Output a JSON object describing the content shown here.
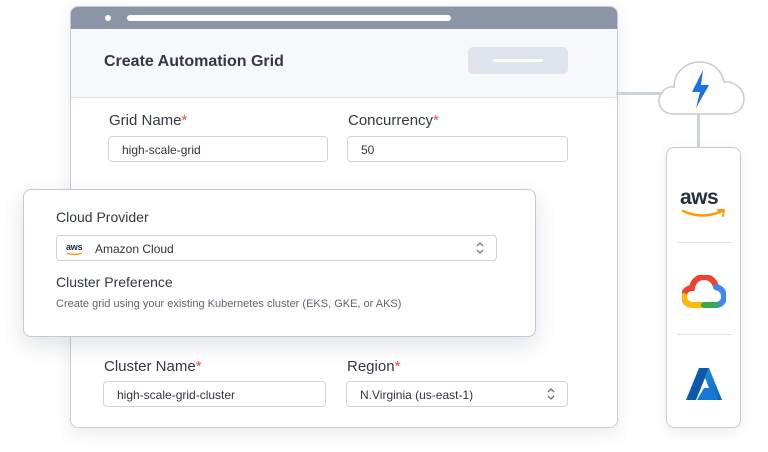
{
  "form": {
    "title": "Create Automation Grid",
    "grid_name_label": "Grid Name",
    "grid_name_value": "high-scale-grid",
    "concurrency_label": "Concurrency",
    "concurrency_value": "50",
    "cluster_name_label": "Cluster Name",
    "cluster_name_value": "high-scale-grid-cluster",
    "region_label": "Region",
    "region_value": "N.Virginia (us-east-1)",
    "required_mark": "*"
  },
  "card": {
    "cloud_provider_label": "Cloud Provider",
    "cloud_provider_value": "Amazon Cloud",
    "cloud_provider_icon_text": "aws",
    "cluster_pref_label": "Cluster Preference",
    "cluster_pref_hint": "Create grid using  your existing Kubernetes cluster (EKS, GKE, or AKS)"
  },
  "providers": {
    "aws_text": "aws",
    "items": [
      "aws-logo",
      "google-cloud-logo",
      "azure-logo"
    ]
  },
  "colors": {
    "required": "#e0554b",
    "titlebar": "#8a96a8",
    "cloud_bolt": "#1e6fe8",
    "aws_orange": "#ff9900",
    "azure_blue": "#0a72c6"
  }
}
